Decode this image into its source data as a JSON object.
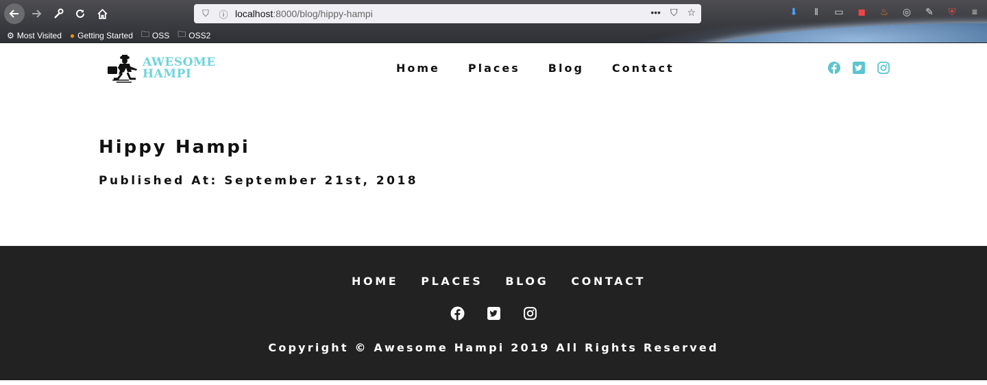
{
  "browser": {
    "url_host": "localhost",
    "url_path": ":8000/blog/hippy-hampi",
    "bookmarks": [
      {
        "label": "Most Visited",
        "icon": "gear-icon"
      },
      {
        "label": "Getting Started",
        "icon": "firefox-icon"
      },
      {
        "label": "OSS",
        "icon": "folder-icon"
      },
      {
        "label": "OSS2",
        "icon": "folder-icon"
      }
    ]
  },
  "site": {
    "logo_line1": "AWESOME",
    "logo_line2": "HAMPI",
    "accent_color": "#6fd5dc",
    "nav": [
      "Home",
      "Places",
      "Blog",
      "Contact"
    ]
  },
  "post": {
    "title": "Hippy Hampi",
    "published": "Published At: September 21st, 2018"
  },
  "footer": {
    "nav": [
      "HOME",
      "PLACES",
      "BLOG",
      "CONTACT"
    ],
    "copyright": "Copyright © Awesome Hampi 2019 All Rights Reserved",
    "background": "#222222"
  }
}
